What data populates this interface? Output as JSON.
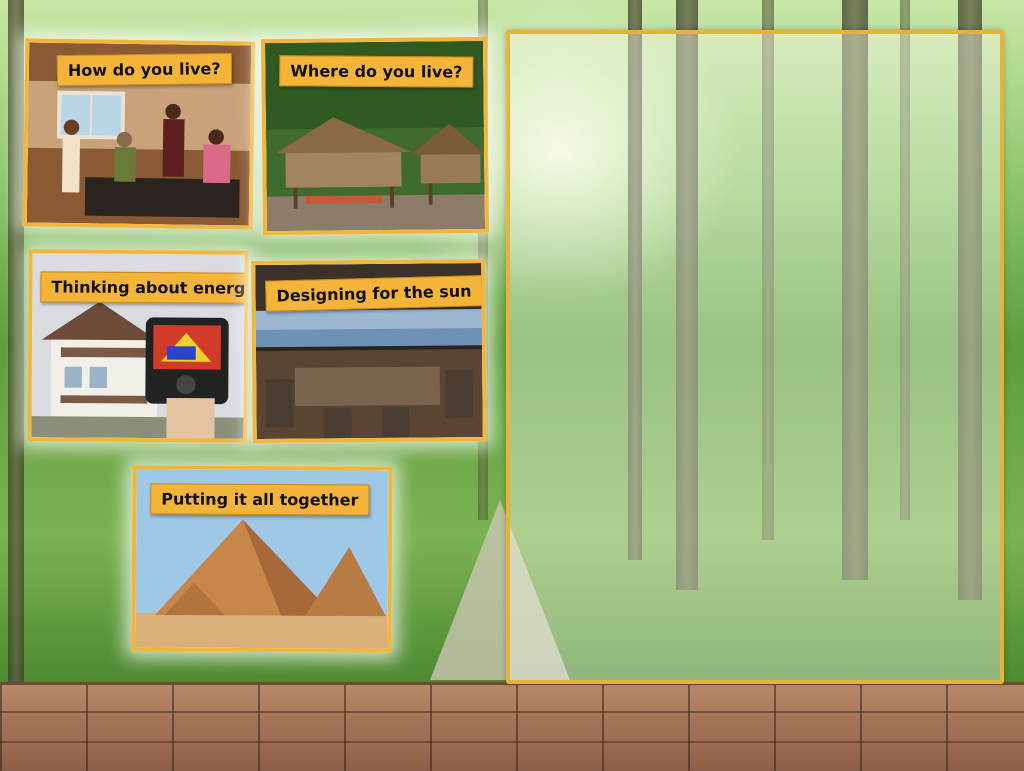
{
  "cards": {
    "how_live": {
      "label": "How do you live?"
    },
    "where_live": {
      "label": "Where do you live?"
    },
    "energy": {
      "label": "Thinking about energy"
    },
    "sun": {
      "label": "Designing for the sun"
    },
    "together": {
      "label": "Putting it all together"
    }
  },
  "colors": {
    "card_border": "#f2b63c",
    "label_bg": "#f4b43a",
    "panel_border": "#e6b23a"
  },
  "icons": {
    "how_live": "family-kitchen-photo",
    "where_live": "stilt-hut-photo",
    "energy": "thermal-camera-photo",
    "sun": "sunny-deck-photo",
    "together": "pyramids-photo"
  }
}
